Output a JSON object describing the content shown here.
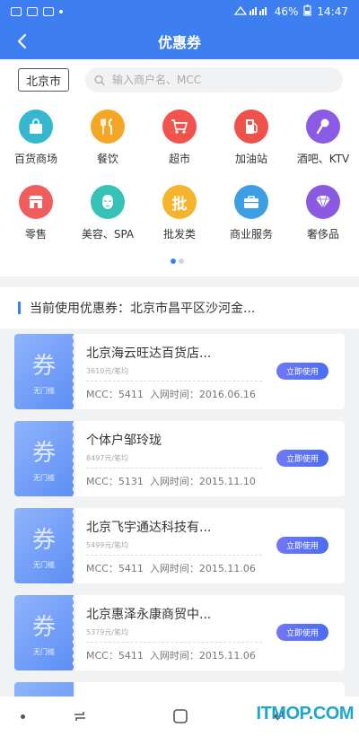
{
  "status_bar": {
    "battery": "46%",
    "time": "14:47"
  },
  "nav": {
    "title": "优惠券"
  },
  "search": {
    "city": "北京市",
    "placeholder": "输入商户名、MCC"
  },
  "categories": [
    {
      "label": "百货商场",
      "icon": "shopping-bag-icon",
      "color": "#35b8cf",
      "glyph": ""
    },
    {
      "label": "餐饮",
      "icon": "fork-knife-icon",
      "color": "#f4a727",
      "glyph": "ψ"
    },
    {
      "label": "超市",
      "icon": "cart-icon",
      "color": "#f0544c",
      "glyph": ""
    },
    {
      "label": "加油站",
      "icon": "fuel-pump-icon",
      "color": "#ee524a",
      "glyph": ""
    },
    {
      "label": "酒吧、KTV",
      "icon": "microphone-icon",
      "color": "#8c5be5",
      "glyph": ""
    },
    {
      "label": "零售",
      "icon": "store-icon",
      "color": "#ef5d5d",
      "glyph": ""
    },
    {
      "label": "美容、SPA",
      "icon": "face-mask-icon",
      "color": "#36c2b6",
      "glyph": ""
    },
    {
      "label": "批发类",
      "icon": "wholesale-icon",
      "color": "#f6b32d",
      "glyph": "批"
    },
    {
      "label": "商业服务",
      "icon": "briefcase-icon",
      "color": "#3c9fe6",
      "glyph": ""
    },
    {
      "label": "奢侈品",
      "icon": "diamond-icon",
      "color": "#8b5ae3",
      "glyph": ""
    }
  ],
  "pager": {
    "pages": 2,
    "current": 1
  },
  "current_coupon": {
    "text": "当前使用优惠券：北京市昌平区沙河金..."
  },
  "coupons": [
    {
      "stub": "券",
      "stub_sub": "无门槛",
      "name": "北京海云旺达百货店...",
      "sub": "3610元/笔均",
      "mcc": "MCC：5411",
      "date": "入网时间：2016.06.16",
      "button": "立即使用"
    },
    {
      "stub": "券",
      "stub_sub": "无门槛",
      "name": "个体户邹玲珑",
      "sub": "8497元/笔均",
      "mcc": "MCC：5131",
      "date": "入网时间：2015.11.10",
      "button": "立即使用"
    },
    {
      "stub": "券",
      "stub_sub": "无门槛",
      "name": "北京飞宇通达科技有...",
      "sub": "5499元/笔均",
      "mcc": "MCC：5411",
      "date": "入网时间：2015.11.06",
      "button": "立即使用"
    },
    {
      "stub": "券",
      "stub_sub": "无门槛",
      "name": "北京惠泽永康商贸中...",
      "sub": "5379元/笔均",
      "mcc": "MCC：5411",
      "date": "入网时间：2015.11.06",
      "button": "立即使用"
    }
  ],
  "watermark": "ITMOP.COM"
}
